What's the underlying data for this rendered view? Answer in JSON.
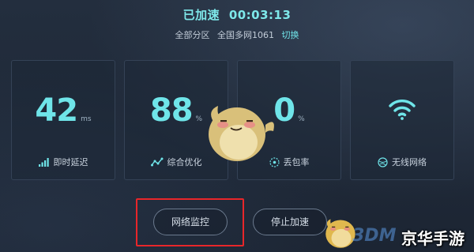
{
  "header": {
    "status": "已加速",
    "timer": "00:03:13",
    "region": "全部分区",
    "network": "全国多网1061",
    "switch_label": "切换"
  },
  "stats": [
    {
      "value": "42",
      "unit": "ms",
      "label": "即时延迟",
      "icon": "signal-bars-icon"
    },
    {
      "value": "88",
      "unit": "%",
      "label": "综合优化",
      "icon": "trend-line-icon"
    },
    {
      "value": "0",
      "unit": "%",
      "label": "丢包率",
      "icon": "packet-loss-icon"
    },
    {
      "value": "",
      "unit": "",
      "label": "无线网络",
      "icon": "wifi-icon"
    }
  ],
  "buttons": {
    "monitor_label": "网络监控",
    "stop_label": "停止加速"
  },
  "watermark": {
    "brand_en": "3DM",
    "brand_cn": "京华手游"
  },
  "colors": {
    "accent": "#6fe5e9",
    "background": "#1e2735",
    "highlight": "#e8262a"
  }
}
